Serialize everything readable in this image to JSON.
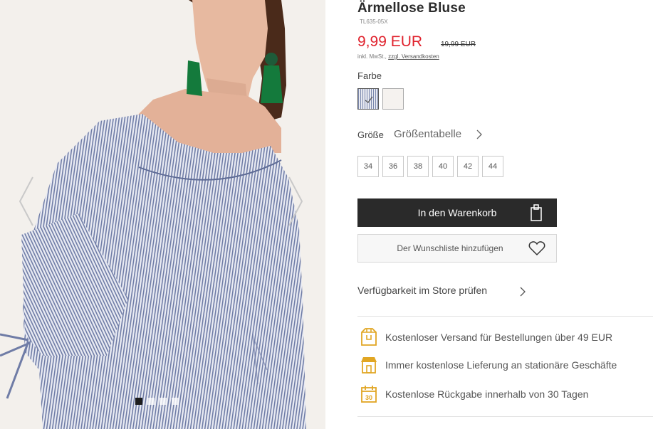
{
  "product": {
    "title": "Ärmellose Bluse",
    "sku": "TL635-05X",
    "price": "9,99 EUR",
    "old_price": "19,99 EUR",
    "tax_note": "inkl. MwSt.,",
    "shipping_link": "zzgl. Versandkosten"
  },
  "color": {
    "label": "Farbe",
    "swatches": [
      {
        "name": "blue-white stripes",
        "selected": true
      },
      {
        "name": "white",
        "selected": false
      }
    ]
  },
  "size": {
    "label": "Größe",
    "guide_link": "Größentabelle",
    "options": [
      "34",
      "36",
      "38",
      "40",
      "42",
      "44"
    ]
  },
  "actions": {
    "add_to_cart": "In den Warenkorb",
    "add_to_wishlist": "Der Wunschliste hinzufügen",
    "store_availability": "Verfügbarkeit im Store prüfen"
  },
  "benefits": [
    {
      "icon": "truck-box-icon",
      "text": "Kostenloser Versand für Bestellungen über 49 EUR"
    },
    {
      "icon": "store-icon",
      "text": "Immer kostenlose Lieferung an stationäre Geschäfte"
    },
    {
      "icon": "calendar-30-icon",
      "text": "Kostenlose Rückgabe innerhalb von 30 Tagen",
      "badge": "30"
    }
  ],
  "gallery": {
    "image_count": 4,
    "active_index": 0
  },
  "colors": {
    "price_red": "#e0222d",
    "cart_button": "#2a2a2a",
    "benefit_icon": "#e1a623"
  }
}
